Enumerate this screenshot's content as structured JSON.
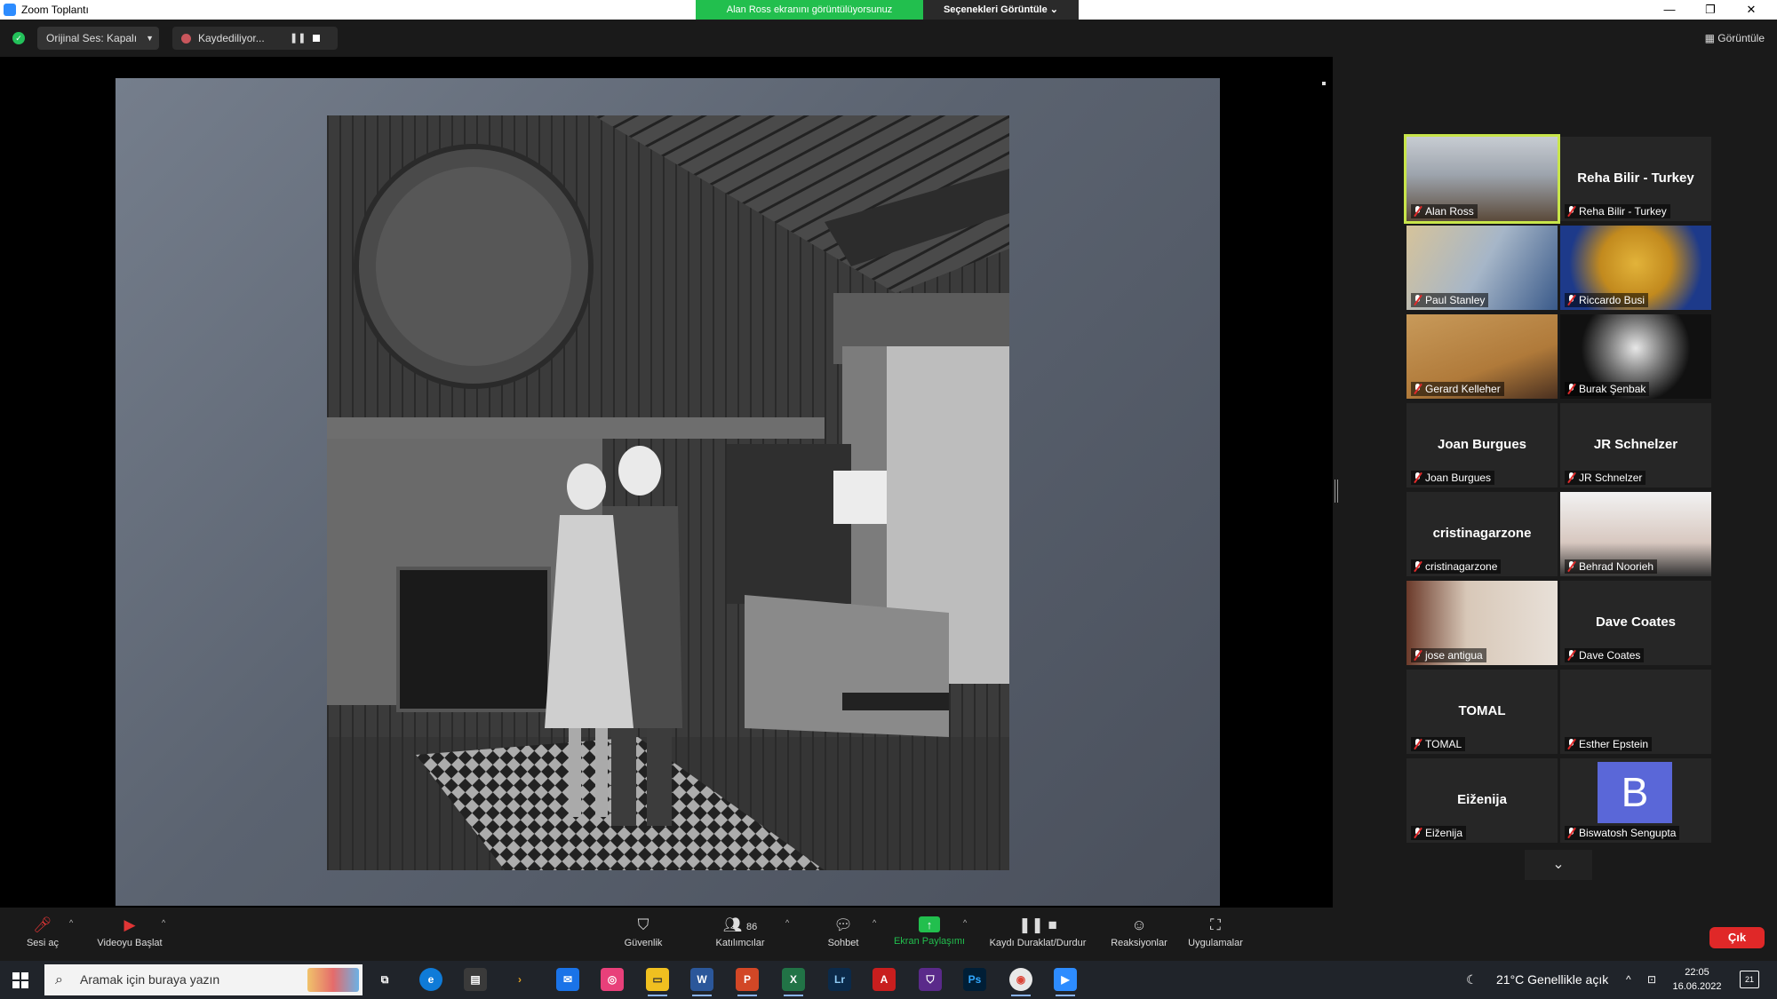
{
  "window": {
    "title": "Zoom Toplantı",
    "share_banner": "Alan Ross ekranını görüntülüyorsunuz",
    "view_options": "Seçenekleri Görüntüle",
    "minimize": "—",
    "maximize": "❐",
    "close": "✕"
  },
  "topbar": {
    "audio_label": "Orijinal Ses: Kapalı",
    "recording_label": "Kaydediliyor...",
    "view_label": "Görüntüle"
  },
  "participants": [
    {
      "name": "Alan Ross",
      "center": "",
      "kind": "video-alan",
      "active": true
    },
    {
      "name": "Reha Bilir - Turkey",
      "center": "Reha Bilir - Turkey",
      "kind": "name"
    },
    {
      "name": "Paul Stanley",
      "center": "",
      "kind": "video-paul"
    },
    {
      "name": "Riccardo Busi",
      "center": "",
      "kind": "video-riccardo"
    },
    {
      "name": "Gerard Kelleher",
      "center": "",
      "kind": "video-gerard"
    },
    {
      "name": "Burak Şenbak",
      "center": "",
      "kind": "video-burak"
    },
    {
      "name": "Joan Burgues",
      "center": "Joan Burgues",
      "kind": "name"
    },
    {
      "name": "JR Schnelzer",
      "center": "JR Schnelzer",
      "kind": "name"
    },
    {
      "name": "cristinagarzone",
      "center": "cristinagarzone",
      "kind": "name"
    },
    {
      "name": "Behrad Noorieh",
      "center": "",
      "kind": "video-behrad"
    },
    {
      "name": "jose antigua",
      "center": "",
      "kind": "video-jose"
    },
    {
      "name": "Dave Coates",
      "center": "Dave Coates",
      "kind": "name"
    },
    {
      "name": "TOMAL",
      "center": "TOMAL",
      "kind": "name"
    },
    {
      "name": "Esther Epstein",
      "center": "",
      "kind": "name"
    },
    {
      "name": "Eiženija",
      "center": "Eiženija",
      "kind": "name"
    },
    {
      "name": "Biswatosh Sengupta",
      "center": "",
      "kind": "avatar",
      "avatar_letter": "B"
    }
  ],
  "toolbar": {
    "unmute": "Sesi aç",
    "start_video": "Videoyu Başlat",
    "security": "Güvenlik",
    "participants": "Katılımcılar",
    "participants_count": "86",
    "chat": "Sohbet",
    "share_screen": "Ekran Paylaşımı",
    "pause_stop_recording": "Kaydı Duraklat/Durdur",
    "reactions": "Reaksiyonlar",
    "apps": "Uygulamalar",
    "leave": "Çık"
  },
  "taskbar": {
    "search_placeholder": "Aramak için buraya yazın",
    "weather": "21°C  Genellikle açık",
    "time": "22:05",
    "date": "16.06.2022",
    "notifications": "21"
  },
  "colors": {
    "share_banner": "#22bf4e",
    "active_speaker": "#c8e54a",
    "leave": "#e02828",
    "avatar": "#5a67d8"
  }
}
